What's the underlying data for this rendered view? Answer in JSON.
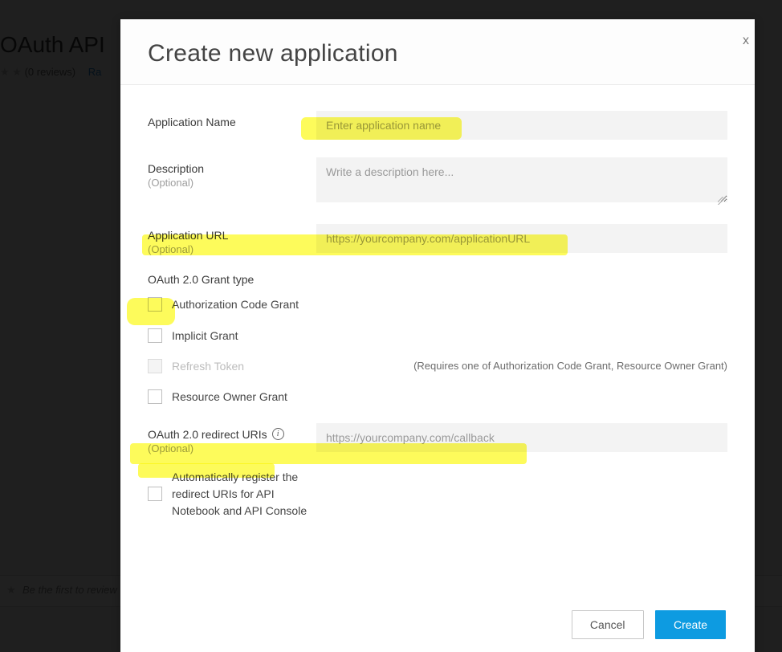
{
  "background": {
    "page_title": "OAuth API ",
    "reviews_text": "(0 reviews)",
    "rate_link": "Ra",
    "footer_prompt": "Be the first to review"
  },
  "modal": {
    "title": "Create new application",
    "close_glyph": "x",
    "fields": {
      "app_name_label": "Application Name",
      "app_name_placeholder": "Enter application name",
      "description_label": "Description",
      "description_optional": "(Optional)",
      "description_placeholder": "Write a description here...",
      "app_url_label": "Application URL",
      "app_url_optional": "(Optional)",
      "app_url_placeholder": "https://yourcompany.com/applicationURL",
      "grant_heading": "OAuth 2.0 Grant type",
      "grant_auth_code": "Authorization Code Grant",
      "grant_implicit": "Implicit Grant",
      "grant_refresh": "Refresh Token",
      "grant_refresh_hint": "(Requires one of Authorization Code Grant, Resource Owner Grant)",
      "grant_resource_owner": "Resource Owner Grant",
      "redirect_label": "OAuth 2.0 redirect URIs",
      "redirect_optional": "(Optional)",
      "redirect_placeholder": "https://yourcompany.com/callback",
      "auto_register_label": "Automatically register the redirect URIs for API Notebook and API Console"
    },
    "buttons": {
      "cancel": "Cancel",
      "create": "Create"
    }
  }
}
